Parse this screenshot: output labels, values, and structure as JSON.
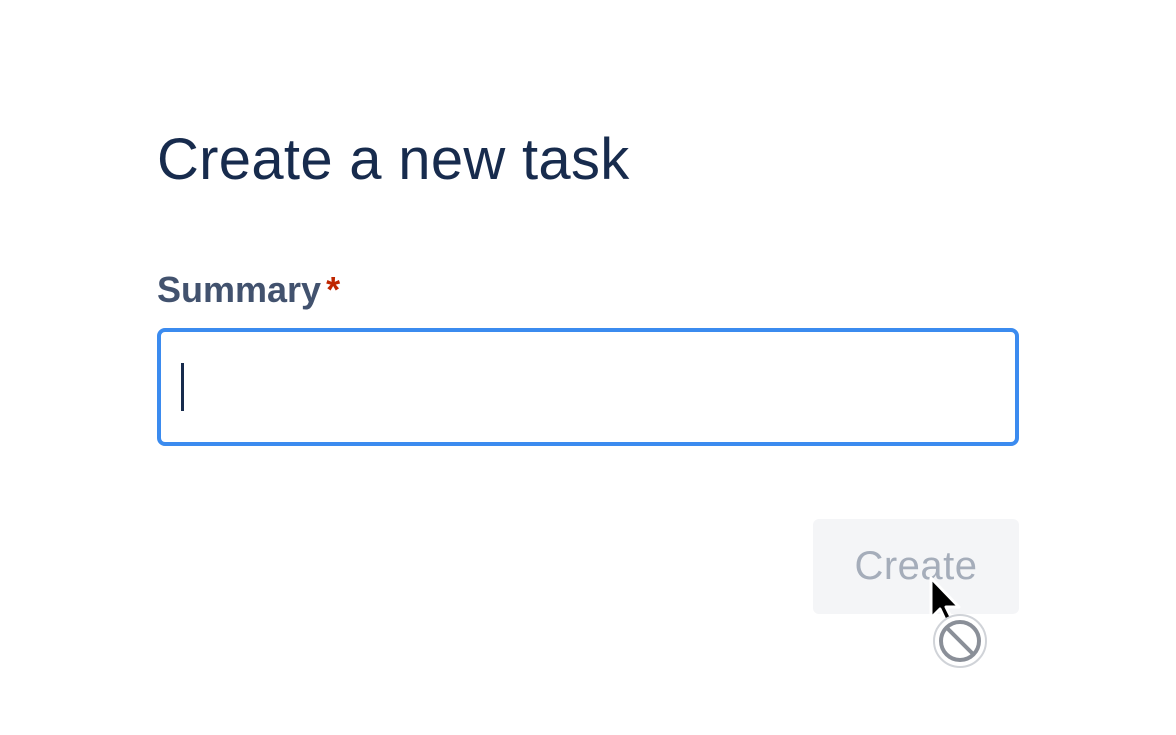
{
  "form": {
    "title": "Create a new task",
    "summary_label": "Summary",
    "required_mark": "*",
    "summary_value": "",
    "create_button": "Create"
  },
  "colors": {
    "title": "#172b4d",
    "label": "#42526e",
    "required": "#bf2600",
    "focus_border": "#3b8bef",
    "disabled_button_bg": "#f4f5f7",
    "disabled_button_text": "#a5adba"
  },
  "cursor": {
    "icon": "not-allowed-cursor-icon"
  }
}
